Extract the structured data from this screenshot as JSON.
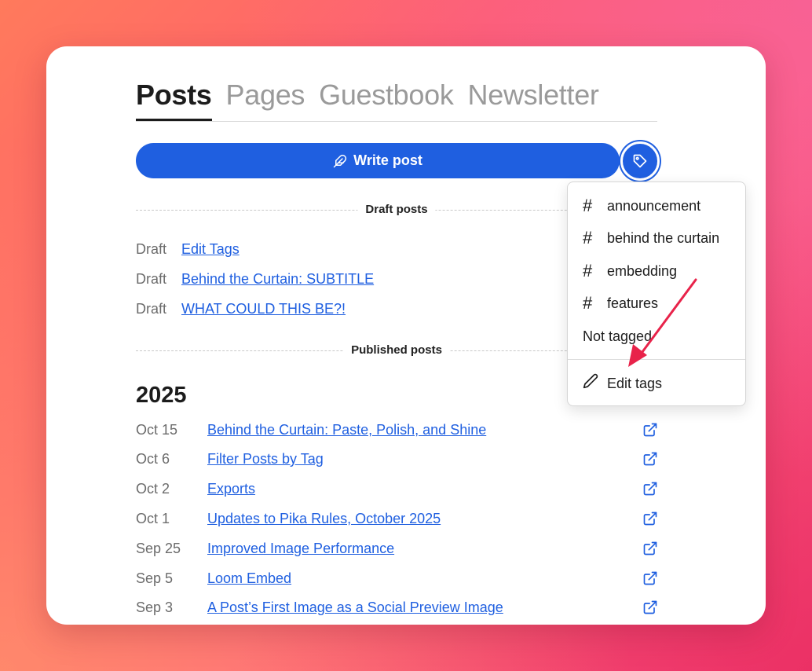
{
  "tabs": [
    {
      "label": "Posts",
      "active": true
    },
    {
      "label": "Pages",
      "active": false
    },
    {
      "label": "Guestbook",
      "active": false
    },
    {
      "label": "Newsletter",
      "active": false
    }
  ],
  "write_button": {
    "label": "Write post",
    "icon": "feather-icon"
  },
  "tag_button": {
    "icon": "tag-icon"
  },
  "sections": {
    "draft_label": "Draft posts",
    "published_label": "Published posts"
  },
  "drafts": [
    {
      "status": "Draft",
      "title": "Edit Tags"
    },
    {
      "status": "Draft",
      "title": "Behind the Curtain: SUBTITLE"
    },
    {
      "status": "Draft",
      "title": "WHAT COULD THIS BE?!"
    }
  ],
  "year": "2025",
  "published": [
    {
      "date": "Oct 15",
      "title": "Behind the Curtain: Paste, Polish, and Shine"
    },
    {
      "date": "Oct 6",
      "title": "Filter Posts by Tag"
    },
    {
      "date": "Oct 2",
      "title": "Exports"
    },
    {
      "date": "Oct 1",
      "title": "Updates to Pika Rules, October 2025"
    },
    {
      "date": "Sep 25",
      "title": "Improved Image Performance"
    },
    {
      "date": "Sep 5",
      "title": "Loom Embed"
    },
    {
      "date": "Sep 3",
      "title": "A Post’s First Image as a Social Preview Image"
    }
  ],
  "tag_menu": {
    "tags": [
      {
        "hash": "#",
        "label": "announcement"
      },
      {
        "hash": "#",
        "label": "behind the curtain"
      },
      {
        "hash": "#",
        "label": "embedding"
      },
      {
        "hash": "#",
        "label": "features"
      }
    ],
    "not_tagged": "Not tagged",
    "edit_tags": "Edit tags"
  },
  "colors": {
    "accent": "#1f5fe0",
    "annotation_arrow": "#e8234a"
  }
}
